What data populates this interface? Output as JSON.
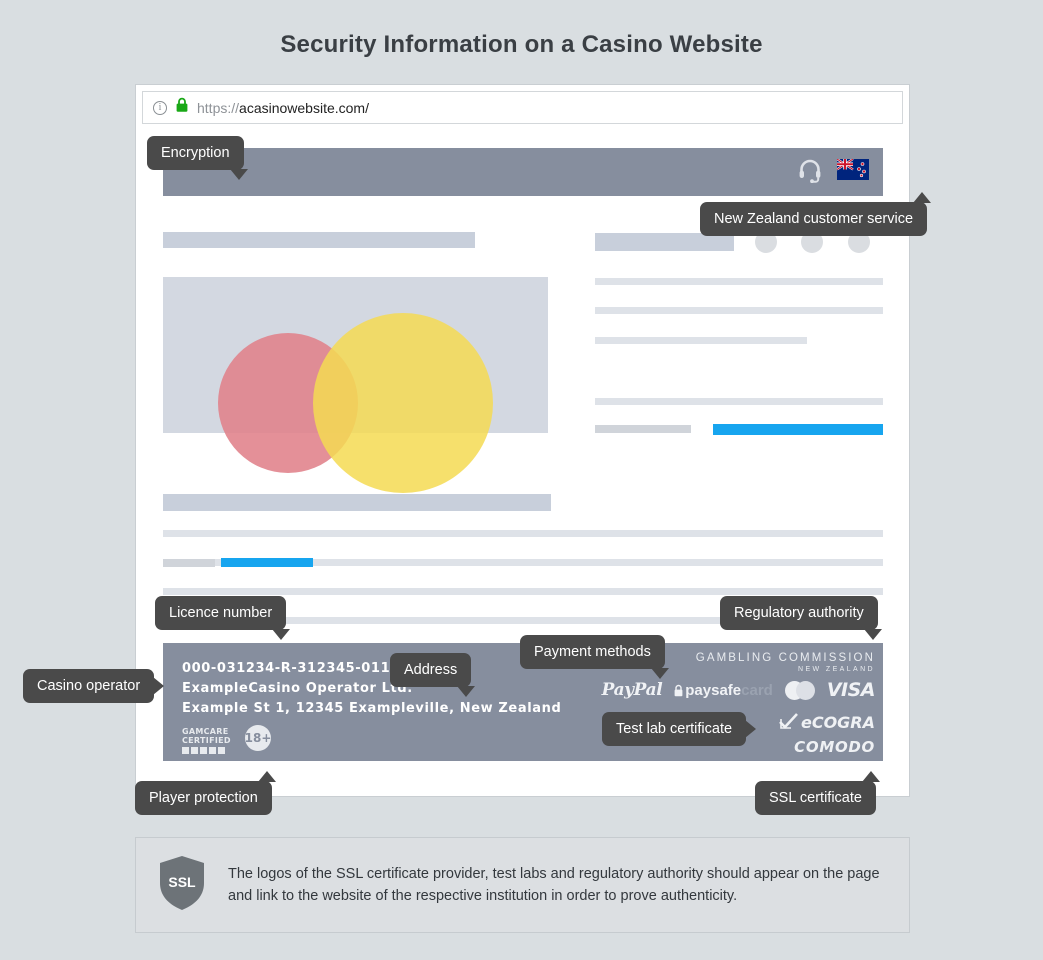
{
  "page": {
    "title": "Security Information on a Casino Website",
    "background_color": "#d9dee1",
    "accent_blue": "#17a5ef",
    "band_color": "#868e9e",
    "callout_color": "#4a4a4a"
  },
  "browser": {
    "url_scheme": "https://",
    "url_host": "acasinowebsite.com/",
    "info_icon": "info-icon",
    "lock_icon": "green-padlock-icon",
    "lock_color": "#1aa817"
  },
  "site_header": {
    "support_icon": "headset-icon",
    "flag_icon": "new-zealand-flag-icon"
  },
  "footer": {
    "licence_number": "000-031234-R-312345-011",
    "operator": "ExampleCasino Operator Ltd.",
    "address": "Example St 1, 12345 Exampleville, New Zealand",
    "gamcare_line1": "GAMCARE",
    "gamcare_line2": "CERTIFIED",
    "age_badge": "18+",
    "regulator_line1": "GAMBLING COMMISSION",
    "regulator_line2": "NEW ZEALAND",
    "payments": [
      "PayPal",
      "paysafecard",
      "mastercard",
      "VISA"
    ],
    "paysafe_bold": "paysafe",
    "paysafe_dim": "card",
    "testlab": "eCOGRA",
    "ssl_provider": "COMODO"
  },
  "callouts": {
    "encryption": "Encryption",
    "customer_service": "New Zealand customer service",
    "licence_number": "Licence number",
    "regulatory_authority": "Regulatory authority",
    "casino_operator": "Casino operator",
    "address": "Address",
    "payment_methods": "Payment methods",
    "test_lab": "Test lab certificate",
    "player_protection": "Player protection",
    "ssl_certificate": "SSL certificate"
  },
  "note": {
    "shield_label": "SSL",
    "text": "The logos of the SSL certificate provider, test labs and regulatory authority should appear on the page and link to the website of the respective institution in order to prove authenticity."
  }
}
